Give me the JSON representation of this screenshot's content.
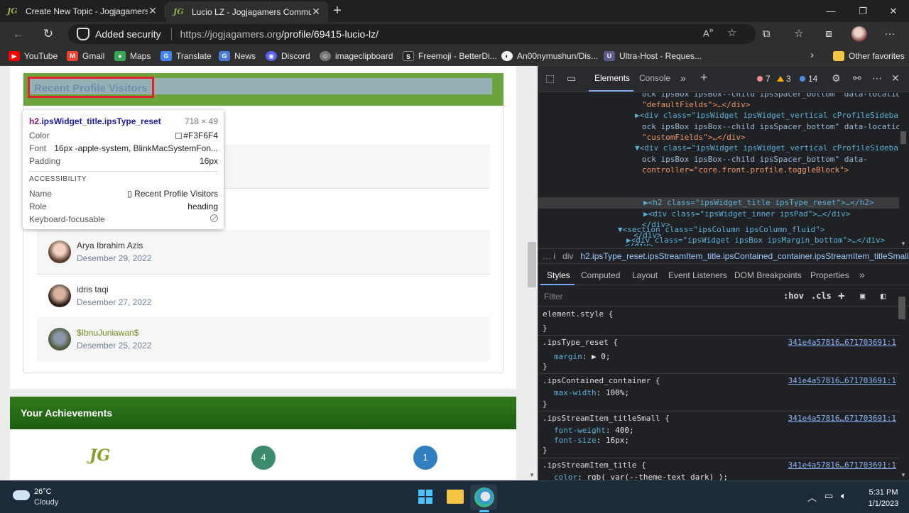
{
  "browser": {
    "tabs": [
      {
        "title": "Create New Topic - Jogjagamers",
        "favicon": "JG"
      },
      {
        "title": "Lucio LZ - Jogjagamers Commun",
        "favicon": "JG"
      }
    ],
    "address": {
      "security": "Added security",
      "url_host": "https://jogjagamers.org",
      "url_path": "/profile/69415-lucio-lz/",
      "read_aloud": "A",
      "read_aloud_sup": "»"
    },
    "bookmarks": [
      {
        "label": "YouTube",
        "color": "#ff0000"
      },
      {
        "label": "Gmail",
        "color": "#ea4335"
      },
      {
        "label": "Maps",
        "color": "#34a853"
      },
      {
        "label": "Translate",
        "color": "#4285f4"
      },
      {
        "label": "News",
        "color": "#4a7bd0"
      },
      {
        "label": "Discord",
        "color": "#5865f2"
      },
      {
        "label": "imageclipboard",
        "color": "#777777"
      },
      {
        "label": "Freemoji - BetterDi...",
        "color": "#222222"
      },
      {
        "label": "An00nymushun/Dis...",
        "color": "#f5f5f5"
      },
      {
        "label": "Ultra-Host - Reques...",
        "color": "#5a5a8a"
      }
    ],
    "other_favorites": "Other favorites"
  },
  "page": {
    "widget_title": "Recent Profile Visitors",
    "visitors": [
      {
        "name": "Arya Ibrahim Azis",
        "date": "Desember 29, 2022"
      },
      {
        "name": "idris taqi",
        "date": "Desember 27, 2022"
      },
      {
        "name": "$IbnuJuniawan$",
        "date": "Desember 25, 2022"
      }
    ],
    "achievements_title": "Your Achievements",
    "achievement_logo": "JG",
    "achievement_counts": [
      "4",
      "1"
    ]
  },
  "tooltip": {
    "selector_tag": "h2",
    "selector_class": ".ipsWidget_title.ipsType_reset",
    "size": "718 × 49",
    "color_label": "Color",
    "color_value": "#F3F6F4",
    "font_label": "Font",
    "font_value": "16px -apple-system, BlinkMacSystemFon...",
    "padding_label": "Padding",
    "padding_value": "16px",
    "accessibility_heading": "ACCESSIBILITY",
    "name_label": "Name",
    "name_value": "▯ Recent Profile Visitors",
    "role_label": "Role",
    "role_value": "heading",
    "focusable_label": "Keyboard-focusable"
  },
  "devtools": {
    "tabs": [
      "Elements",
      "Console"
    ],
    "errors": "7",
    "warnings": "3",
    "issues": "14",
    "dom": [
      {
        "indent": 0,
        "text": "ock ipsBox ipsBox--child ipsSpacer_bottom\" data-location="
      },
      {
        "indent": 1,
        "text": "\"defaultFields\">…</div>"
      },
      {
        "indent": 2,
        "text": "▶<div class=\"ipsWidget ipsWidget_vertical cProfileSidebarBl"
      },
      {
        "indent": 3,
        "text": "ock ipsBox ipsBox--child ipsSpacer_bottom\" data-location="
      },
      {
        "indent": 4,
        "text": "\"customFields\">…</div>"
      },
      {
        "indent": 5,
        "text": "▼<div class=\"ipsWidget ipsWidget_vertical cProfileSidebarBl"
      },
      {
        "indent": 6,
        "text": "ock ipsBox ipsBox--child ipsSpacer_bottom\" data-"
      },
      {
        "indent": 7,
        "text": "controller=\"core.front.profile.toggleBlock\">"
      },
      {
        "indent": 8,
        "text": "▶<h2 class=\"ipsWidget_title ipsType_reset\">…</h2>"
      },
      {
        "indent": 9,
        "text": "▶<div class=\"ipsWidget_inner ipsPad\">…</div>"
      },
      {
        "indent": 10,
        "text": "</div>"
      },
      {
        "indent": 11,
        "text": "</div>"
      },
      {
        "indent": 12,
        "text": "</div>"
      },
      {
        "indent": 13,
        "text": "▼<section class=\"ipsColumn ipsColumn_fluid\">"
      },
      {
        "indent": 14,
        "text": "▶<div class=\"ipsWidget ipsBox ipsMargin_bottom\">…</div>"
      }
    ],
    "breadcrumb_lead": "… i",
    "breadcrumb_div": "div",
    "breadcrumb_selected": "h2.ipsType_reset.ipsStreamItem_title.ipsContained_container.ipsStreamItem_titleSmall",
    "subtabs": [
      "Styles",
      "Computed",
      "Layout",
      "Event Listeners",
      "DOM Breakpoints",
      "Properties"
    ],
    "filter_placeholder": "Filter",
    "hov": ":hov",
    "cls": ".cls",
    "rules": [
      {
        "selector": "element.style {",
        "props": [],
        "source": ""
      },
      {
        "selector": ".ipsType_reset {",
        "props": [
          {
            "name": "margin",
            "value": "▶ 0;"
          }
        ],
        "source": "341e4a57816…671703691:1"
      },
      {
        "selector": ".ipsContained_container {",
        "props": [
          {
            "name": "max-width",
            "value": "100%;"
          }
        ],
        "source": "341e4a57816…671703691:1"
      },
      {
        "selector": ".ipsStreamItem_titleSmall {",
        "props": [
          {
            "name": "font-weight",
            "value": "400;"
          },
          {
            "name": "font-size",
            "value": "16px;"
          }
        ],
        "source": "341e4a57816…671703691:1"
      },
      {
        "selector": ".ipsStreamItem_title {",
        "props": [
          {
            "name": "color",
            "value": "rgb( var(--theme-text_dark) );"
          }
        ],
        "source": "341e4a57816…671703691:1"
      }
    ]
  },
  "taskbar": {
    "temp": "26°C",
    "weather": "Cloudy",
    "time": "5:31 PM",
    "date": "1/1/2023"
  }
}
